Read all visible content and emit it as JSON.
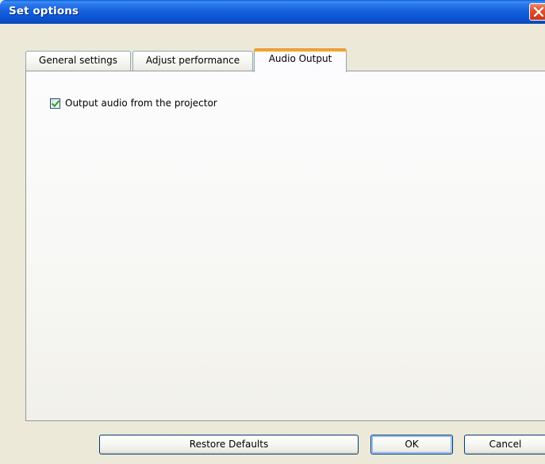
{
  "window": {
    "title": "Set options"
  },
  "tabs": [
    {
      "label": "General settings",
      "active": false
    },
    {
      "label": "Adjust performance",
      "active": false
    },
    {
      "label": "Audio Output",
      "active": true
    }
  ],
  "audio_output": {
    "output_audio_checkbox": {
      "label": "Output audio from the projector",
      "checked": true
    }
  },
  "buttons": {
    "restore_defaults": "Restore Defaults",
    "ok": "OK",
    "cancel": "Cancel"
  },
  "colors": {
    "titlebar": "#0a4fc8",
    "active_tab_accent": "#f0a72e",
    "dialog_background": "#ece9d8",
    "close_button": "#e0532f",
    "checkmark": "#21a121"
  },
  "icons": {
    "close": "close-icon",
    "check": "checkmark-icon"
  }
}
